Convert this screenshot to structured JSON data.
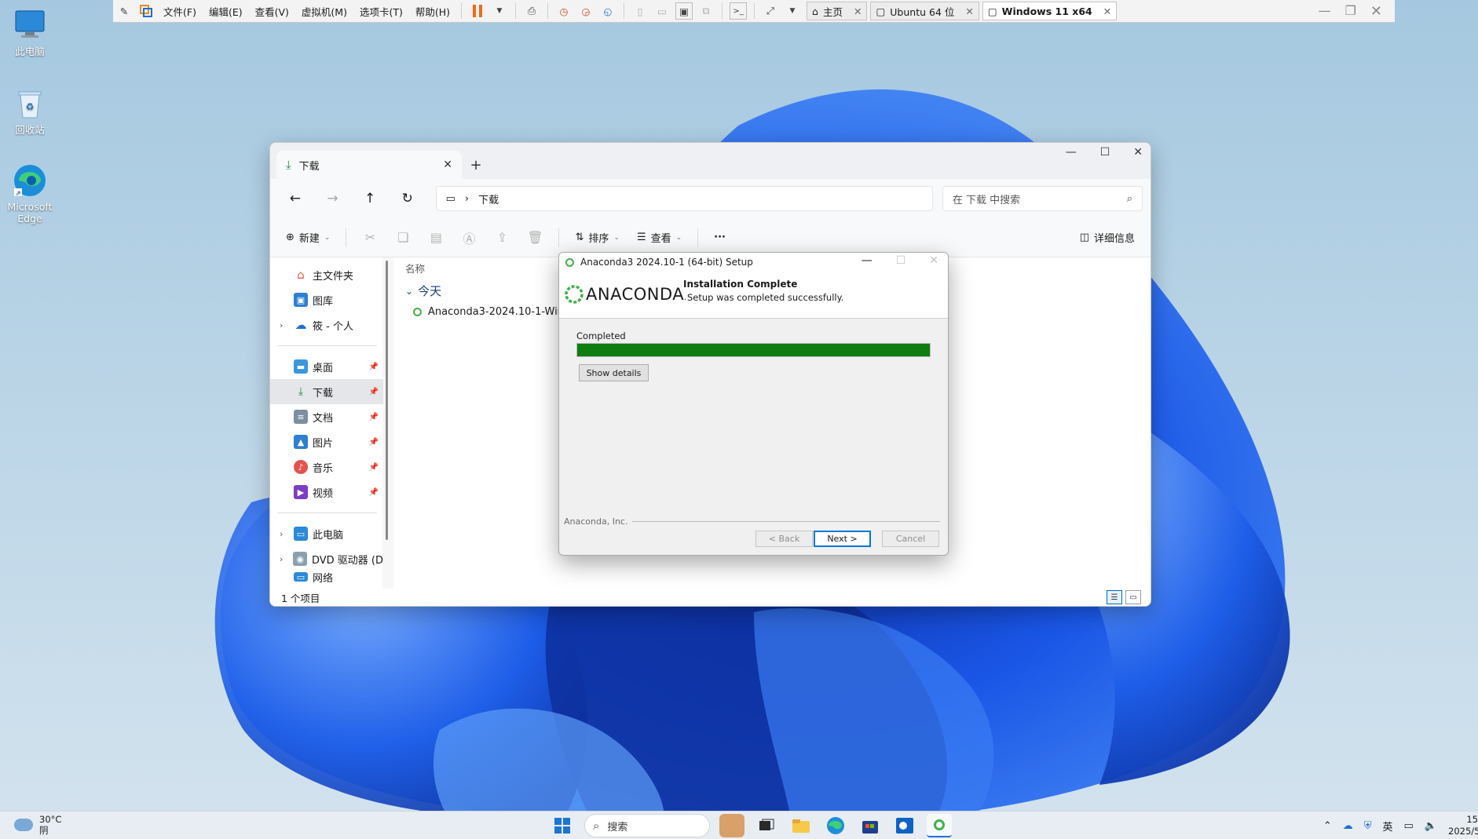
{
  "vm_toolbar": {
    "menus": [
      "文件(F)",
      "编辑(E)",
      "查看(V)",
      "虚拟机(M)",
      "选项卡(T)",
      "帮助(H)"
    ],
    "tabs": [
      {
        "label": "主页"
      },
      {
        "label": "Ubuntu 64 位"
      },
      {
        "label": "Windows 11 x64"
      }
    ]
  },
  "desktop": {
    "icons": [
      {
        "label": "此电脑"
      },
      {
        "label": "回收站"
      },
      {
        "label": "Microsoft Edge"
      }
    ]
  },
  "explorer": {
    "tab_title": "下载",
    "breadcrumb": "下载",
    "search_placeholder": "在 下载 中搜索",
    "commands": {
      "new": "新建",
      "sort": "排序",
      "view": "查看",
      "more": "···",
      "details": "详细信息"
    },
    "nav": {
      "top": [
        "主文件夹",
        "图库",
        "筱 - 个人"
      ],
      "pinned": [
        "桌面",
        "下载",
        "文档",
        "图片",
        "音乐",
        "视频"
      ],
      "devices": [
        "此电脑",
        "DVD 驱动器 (D",
        "网络"
      ]
    },
    "column_name": "名称",
    "group": "今天",
    "file_name": "Anaconda3-2024.10-1-Windo",
    "status": "1 个项目"
  },
  "setup": {
    "title": "Anaconda3 2024.10-1 (64-bit) Setup",
    "logo_text": "ANACONDA",
    "logo_suffix": ".",
    "header_title": "Installation Complete",
    "header_subtitle": "Setup was completed successfully.",
    "progress_label": "Completed",
    "progress_fraction": 1.0,
    "show_details": "Show details",
    "footer": "Anaconda, Inc.",
    "buttons": {
      "back": "< Back",
      "next": "Next >",
      "cancel": "Cancel"
    }
  },
  "taskbar": {
    "weather_temp": "30°C",
    "weather_desc": "阴",
    "search_label": "搜索",
    "ime": "英",
    "clock_time": "15",
    "clock_date": "2025/5"
  },
  "colors": {
    "progress": "#0f7d0f",
    "anaconda_green": "#43b049",
    "wallpaper_blue": "#1a5ee0"
  }
}
